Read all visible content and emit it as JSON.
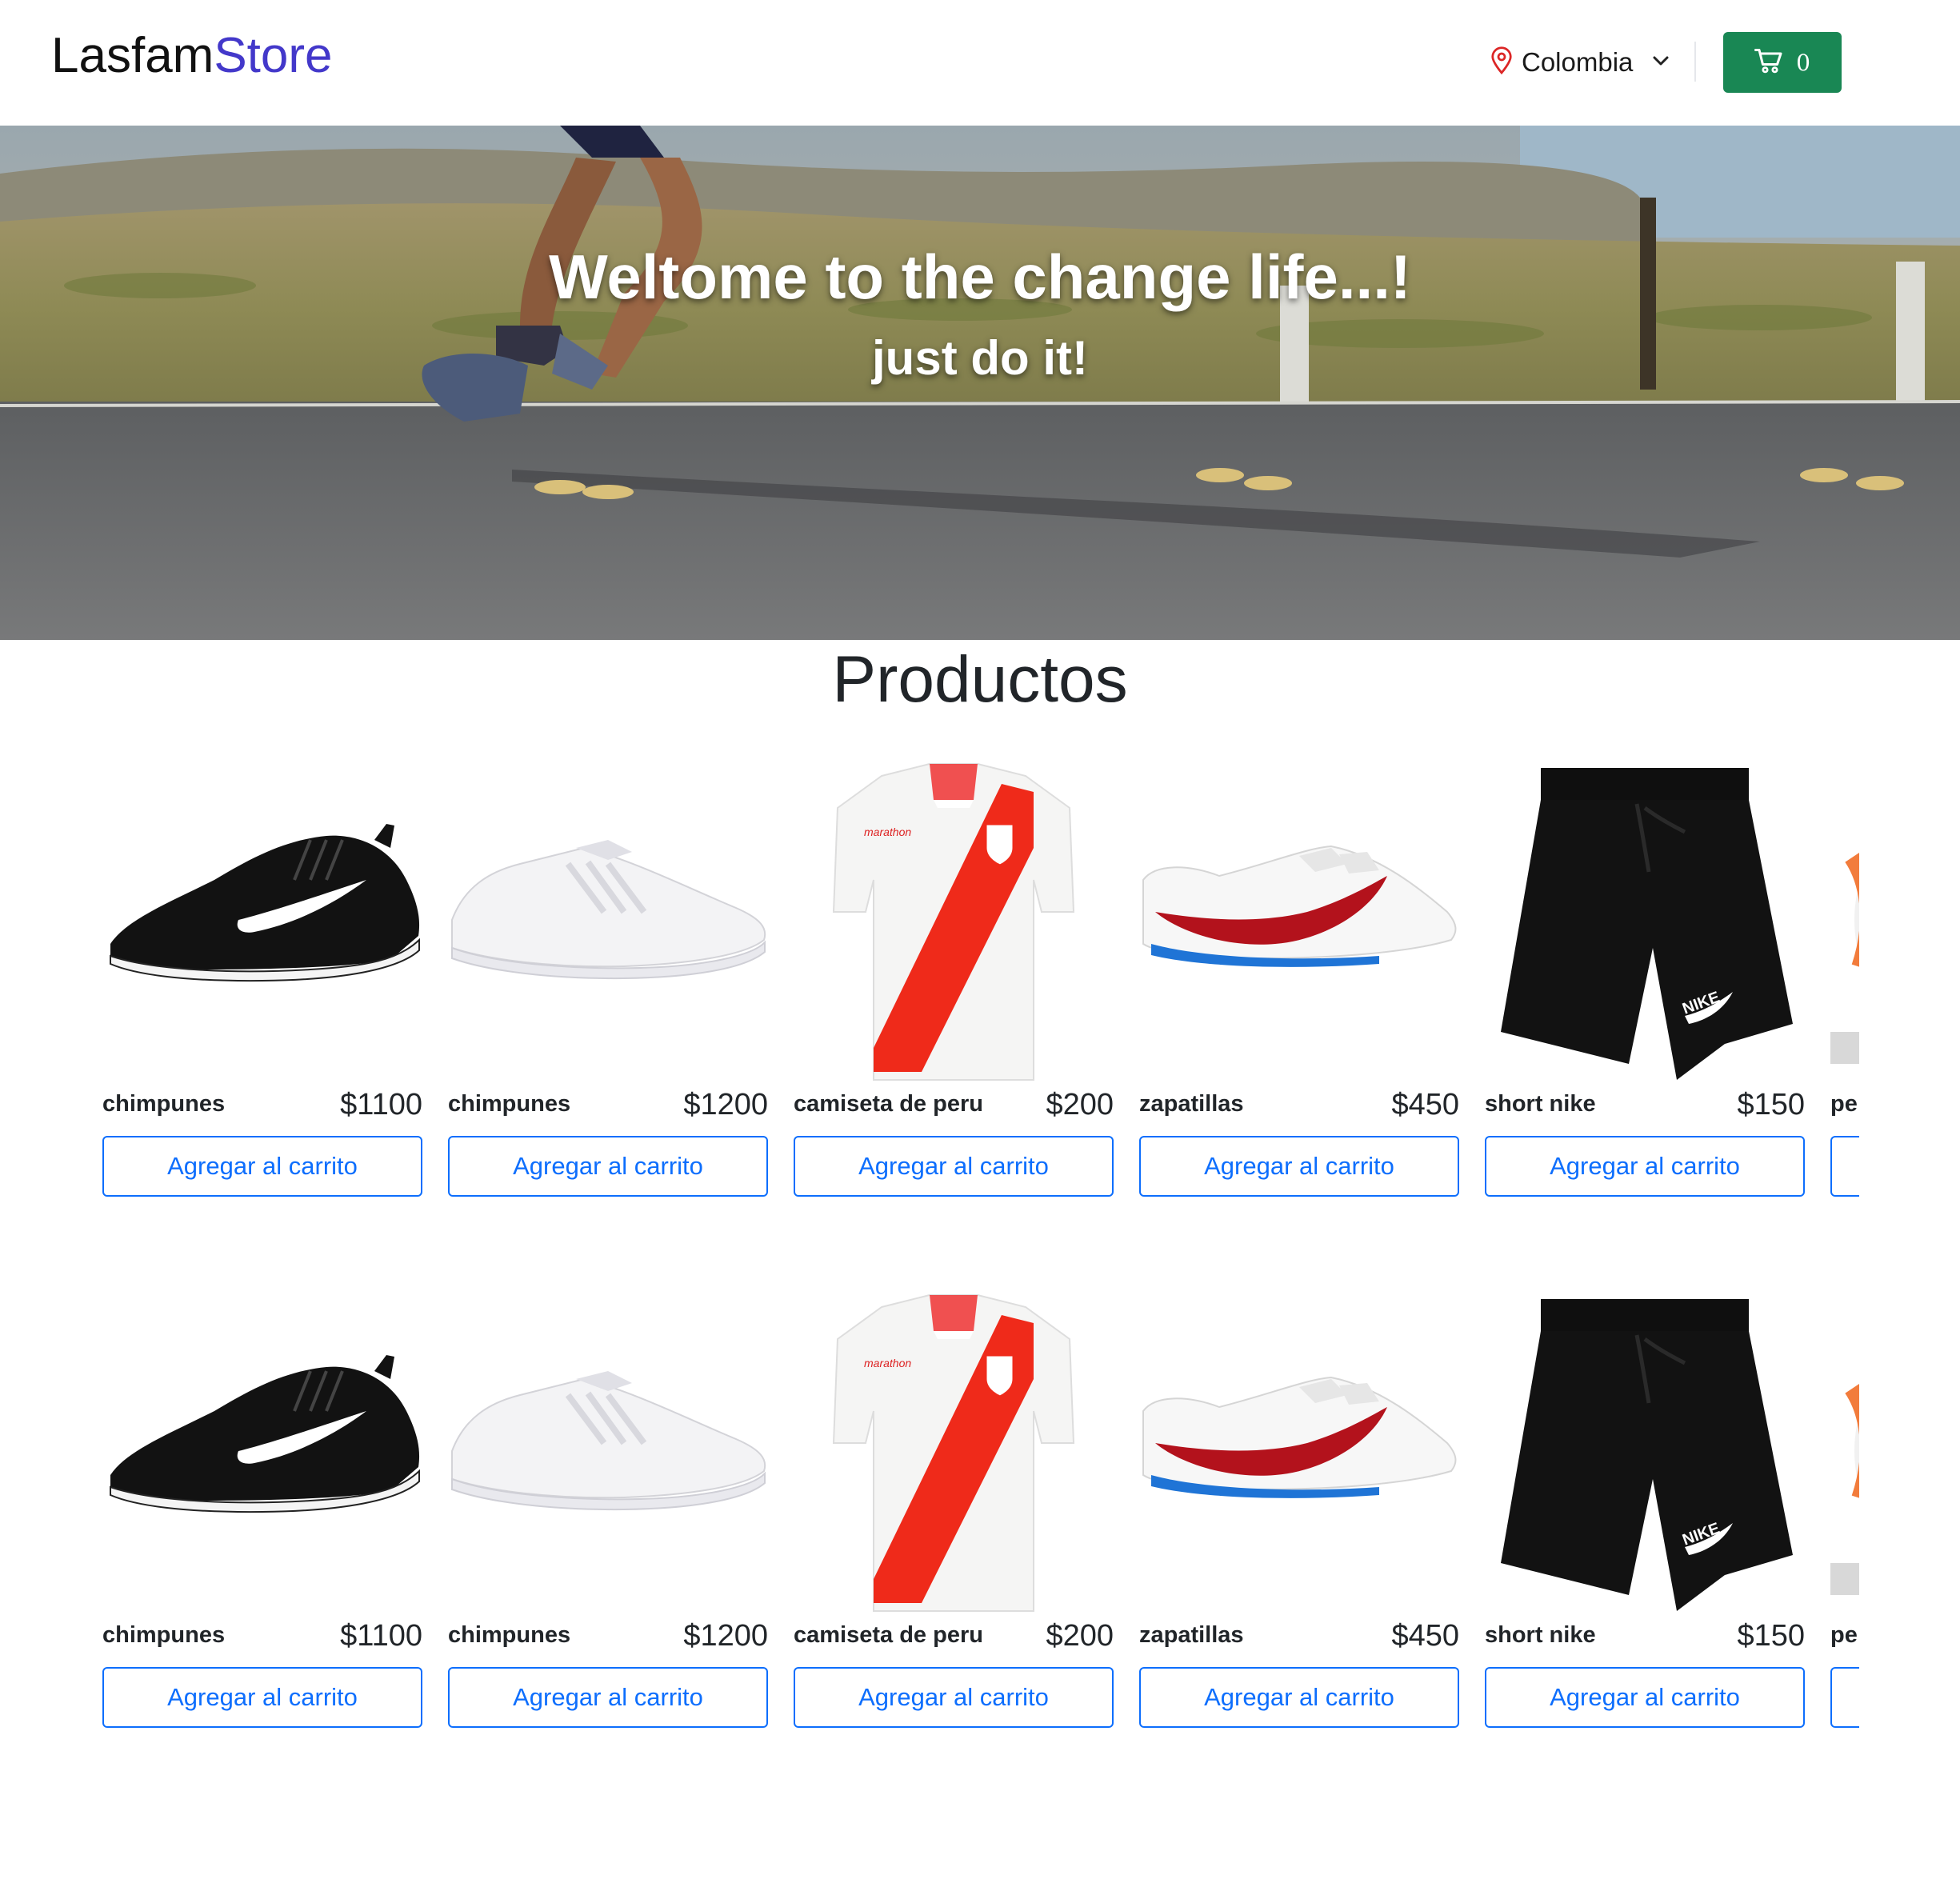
{
  "header": {
    "brand_part1": "Lasfam",
    "brand_part2": "Store",
    "location": "Colombia",
    "cart_count": "0"
  },
  "hero": {
    "title": "Weltome to the change life...!",
    "subtitle": "just do it!"
  },
  "products_section": {
    "title": "Productos",
    "button_label": "Agregar al carrito",
    "rows": [
      [
        {
          "name": "chimpunes",
          "price": "$1100",
          "image": "black-sneaker"
        },
        {
          "name": "chimpunes",
          "price": "$1200",
          "image": "white-sneaker"
        },
        {
          "name": "camiseta de peru",
          "price": "$200",
          "image": "peru-jersey"
        },
        {
          "name": "zapatillas",
          "price": "$450",
          "image": "red-swoosh-sneaker"
        },
        {
          "name": "short nike",
          "price": "$150",
          "image": "black-shorts"
        },
        {
          "name": "pe",
          "price": "",
          "image": "ball-partial"
        }
      ],
      [
        {
          "name": "chimpunes",
          "price": "$1100",
          "image": "black-sneaker"
        },
        {
          "name": "chimpunes",
          "price": "$1200",
          "image": "white-sneaker"
        },
        {
          "name": "camiseta de peru",
          "price": "$200",
          "image": "peru-jersey"
        },
        {
          "name": "zapatillas",
          "price": "$450",
          "image": "red-swoosh-sneaker"
        },
        {
          "name": "short nike",
          "price": "$150",
          "image": "black-shorts"
        },
        {
          "name": "pe",
          "price": "",
          "image": "ball-partial"
        }
      ]
    ]
  },
  "colors": {
    "brand_accent": "#4338ca",
    "cart_button": "#198754",
    "add_button": "#0d6efd",
    "location_pin": "#dc2626"
  },
  "icons": {
    "location": "map-pin-icon",
    "chevron": "chevron-down-icon",
    "cart": "shopping-cart-icon"
  }
}
